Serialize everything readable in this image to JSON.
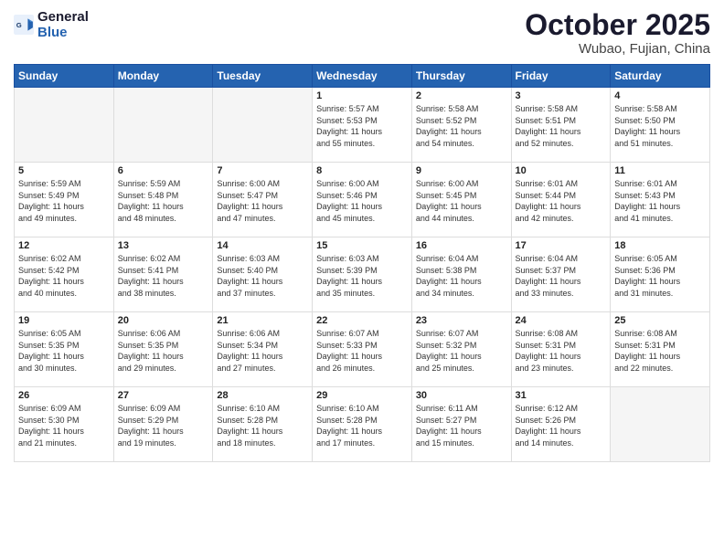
{
  "header": {
    "logo_line1": "General",
    "logo_line2": "Blue",
    "month_title": "October 2025",
    "location": "Wubao, Fujian, China"
  },
  "weekdays": [
    "Sunday",
    "Monday",
    "Tuesday",
    "Wednesday",
    "Thursday",
    "Friday",
    "Saturday"
  ],
  "weeks": [
    [
      {
        "day": "",
        "info": ""
      },
      {
        "day": "",
        "info": ""
      },
      {
        "day": "",
        "info": ""
      },
      {
        "day": "1",
        "info": "Sunrise: 5:57 AM\nSunset: 5:53 PM\nDaylight: 11 hours\nand 55 minutes."
      },
      {
        "day": "2",
        "info": "Sunrise: 5:58 AM\nSunset: 5:52 PM\nDaylight: 11 hours\nand 54 minutes."
      },
      {
        "day": "3",
        "info": "Sunrise: 5:58 AM\nSunset: 5:51 PM\nDaylight: 11 hours\nand 52 minutes."
      },
      {
        "day": "4",
        "info": "Sunrise: 5:58 AM\nSunset: 5:50 PM\nDaylight: 11 hours\nand 51 minutes."
      }
    ],
    [
      {
        "day": "5",
        "info": "Sunrise: 5:59 AM\nSunset: 5:49 PM\nDaylight: 11 hours\nand 49 minutes."
      },
      {
        "day": "6",
        "info": "Sunrise: 5:59 AM\nSunset: 5:48 PM\nDaylight: 11 hours\nand 48 minutes."
      },
      {
        "day": "7",
        "info": "Sunrise: 6:00 AM\nSunset: 5:47 PM\nDaylight: 11 hours\nand 47 minutes."
      },
      {
        "day": "8",
        "info": "Sunrise: 6:00 AM\nSunset: 5:46 PM\nDaylight: 11 hours\nand 45 minutes."
      },
      {
        "day": "9",
        "info": "Sunrise: 6:00 AM\nSunset: 5:45 PM\nDaylight: 11 hours\nand 44 minutes."
      },
      {
        "day": "10",
        "info": "Sunrise: 6:01 AM\nSunset: 5:44 PM\nDaylight: 11 hours\nand 42 minutes."
      },
      {
        "day": "11",
        "info": "Sunrise: 6:01 AM\nSunset: 5:43 PM\nDaylight: 11 hours\nand 41 minutes."
      }
    ],
    [
      {
        "day": "12",
        "info": "Sunrise: 6:02 AM\nSunset: 5:42 PM\nDaylight: 11 hours\nand 40 minutes."
      },
      {
        "day": "13",
        "info": "Sunrise: 6:02 AM\nSunset: 5:41 PM\nDaylight: 11 hours\nand 38 minutes."
      },
      {
        "day": "14",
        "info": "Sunrise: 6:03 AM\nSunset: 5:40 PM\nDaylight: 11 hours\nand 37 minutes."
      },
      {
        "day": "15",
        "info": "Sunrise: 6:03 AM\nSunset: 5:39 PM\nDaylight: 11 hours\nand 35 minutes."
      },
      {
        "day": "16",
        "info": "Sunrise: 6:04 AM\nSunset: 5:38 PM\nDaylight: 11 hours\nand 34 minutes."
      },
      {
        "day": "17",
        "info": "Sunrise: 6:04 AM\nSunset: 5:37 PM\nDaylight: 11 hours\nand 33 minutes."
      },
      {
        "day": "18",
        "info": "Sunrise: 6:05 AM\nSunset: 5:36 PM\nDaylight: 11 hours\nand 31 minutes."
      }
    ],
    [
      {
        "day": "19",
        "info": "Sunrise: 6:05 AM\nSunset: 5:35 PM\nDaylight: 11 hours\nand 30 minutes."
      },
      {
        "day": "20",
        "info": "Sunrise: 6:06 AM\nSunset: 5:35 PM\nDaylight: 11 hours\nand 29 minutes."
      },
      {
        "day": "21",
        "info": "Sunrise: 6:06 AM\nSunset: 5:34 PM\nDaylight: 11 hours\nand 27 minutes."
      },
      {
        "day": "22",
        "info": "Sunrise: 6:07 AM\nSunset: 5:33 PM\nDaylight: 11 hours\nand 26 minutes."
      },
      {
        "day": "23",
        "info": "Sunrise: 6:07 AM\nSunset: 5:32 PM\nDaylight: 11 hours\nand 25 minutes."
      },
      {
        "day": "24",
        "info": "Sunrise: 6:08 AM\nSunset: 5:31 PM\nDaylight: 11 hours\nand 23 minutes."
      },
      {
        "day": "25",
        "info": "Sunrise: 6:08 AM\nSunset: 5:31 PM\nDaylight: 11 hours\nand 22 minutes."
      }
    ],
    [
      {
        "day": "26",
        "info": "Sunrise: 6:09 AM\nSunset: 5:30 PM\nDaylight: 11 hours\nand 21 minutes."
      },
      {
        "day": "27",
        "info": "Sunrise: 6:09 AM\nSunset: 5:29 PM\nDaylight: 11 hours\nand 19 minutes."
      },
      {
        "day": "28",
        "info": "Sunrise: 6:10 AM\nSunset: 5:28 PM\nDaylight: 11 hours\nand 18 minutes."
      },
      {
        "day": "29",
        "info": "Sunrise: 6:10 AM\nSunset: 5:28 PM\nDaylight: 11 hours\nand 17 minutes."
      },
      {
        "day": "30",
        "info": "Sunrise: 6:11 AM\nSunset: 5:27 PM\nDaylight: 11 hours\nand 15 minutes."
      },
      {
        "day": "31",
        "info": "Sunrise: 6:12 AM\nSunset: 5:26 PM\nDaylight: 11 hours\nand 14 minutes."
      },
      {
        "day": "",
        "info": ""
      }
    ]
  ]
}
